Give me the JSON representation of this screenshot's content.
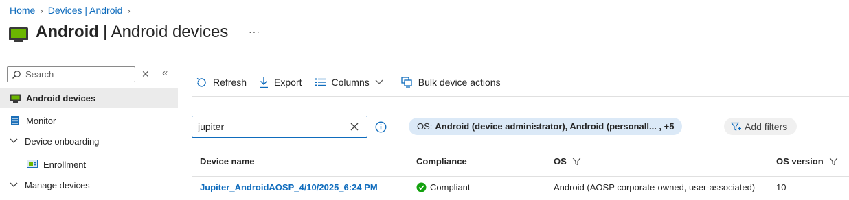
{
  "breadcrumb": {
    "home": "Home",
    "devices": "Devices | Android"
  },
  "title": {
    "bold": "Android",
    "rest": "| Android devices",
    "more": "···"
  },
  "sidebar": {
    "search_placeholder": "Search",
    "items": [
      {
        "label": "Android devices",
        "icon": "android-device-icon",
        "active": true
      },
      {
        "label": "Monitor",
        "icon": "monitor-icon"
      },
      {
        "label": "Device onboarding",
        "icon": "chevron-down-icon"
      },
      {
        "label": "Enrollment",
        "icon": "enrollment-icon"
      },
      {
        "label": "Manage devices",
        "icon": "chevron-down-icon"
      }
    ]
  },
  "toolbar": {
    "refresh": "Refresh",
    "export": "Export",
    "columns": "Columns",
    "bulk": "Bulk device actions"
  },
  "filter": {
    "value": "jupiter",
    "os_prefix": "OS:",
    "os_value": "Android (device administrator), Android (personall... , +5",
    "add_filters": "Add filters"
  },
  "table": {
    "headers": {
      "device_name": "Device name",
      "compliance": "Compliance",
      "os": "OS",
      "os_version": "OS version"
    },
    "rows": [
      {
        "device_name": "Jupiter_AndroidAOSP_4/10/2025_6:24 PM",
        "compliance": "Compliant",
        "os": "Android (AOSP corporate-owned, user-associated)",
        "os_version": "10"
      }
    ]
  },
  "colors": {
    "accent": "#0f6cbd",
    "pill": "#dbe9f7",
    "compliant": "#13a10e",
    "active_nav": "#ebebeb"
  }
}
